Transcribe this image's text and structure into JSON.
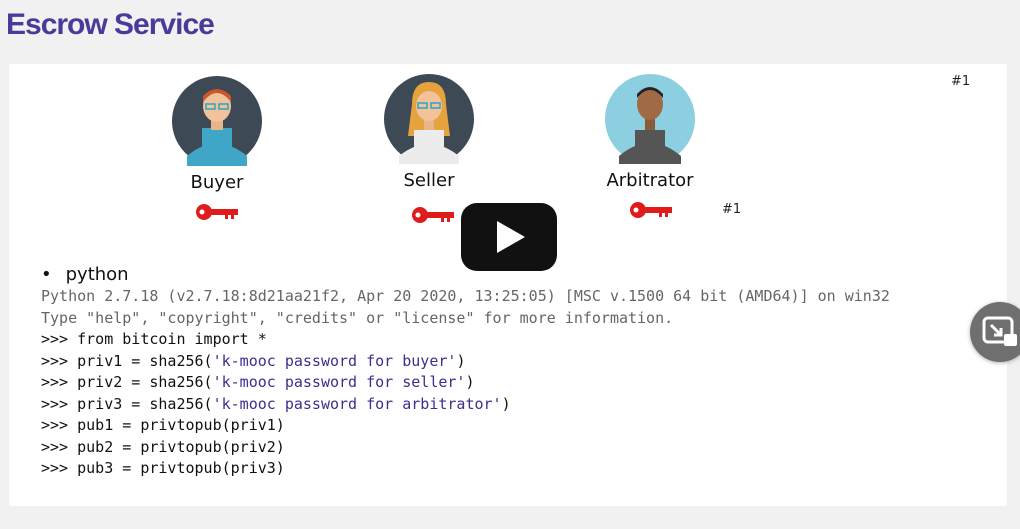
{
  "header": {
    "title": "Escrow Service"
  },
  "slide": {
    "top_ref": "#1",
    "key_ref": "#1",
    "people": [
      {
        "role": "Buyer"
      },
      {
        "role": "Seller"
      },
      {
        "role": "Arbitrator"
      }
    ],
    "bullet": "python",
    "code": {
      "banner1": "Python 2.7.18 (v2.7.18:8d21aa21f2, Apr 20 2020, 13:25:05) [MSC v.1500 64 bit (AMD64)] on win32",
      "banner2": "Type \"help\", \"copyright\", \"credits\" or \"license\" for more information.",
      "line1": ">>> from bitcoin import *",
      "line2_pre": ">>> priv1 = sha256(",
      "line2_str": "'k-mooc password for buyer'",
      "line2_post": ")",
      "line3_pre": ">>> priv2 = sha256(",
      "line3_str": "'k-mooc password for seller'",
      "line3_post": ")",
      "line4_pre": ">>> priv3 = sha256(",
      "line4_str": "'k-mooc password for arbitrator'",
      "line4_post": ")",
      "line5": ">>> pub1 = privtopub(priv1)",
      "line6": ">>> pub2 = privtopub(priv2)",
      "line7": ">>> pub3 = privtopub(priv3)"
    }
  },
  "colors": {
    "title": "#4b3a99",
    "key": "#e01b1b",
    "string": "#3b2f8f"
  },
  "icons": {
    "play": "play-icon",
    "pip": "picture-in-picture-icon",
    "key": "key-icon"
  }
}
